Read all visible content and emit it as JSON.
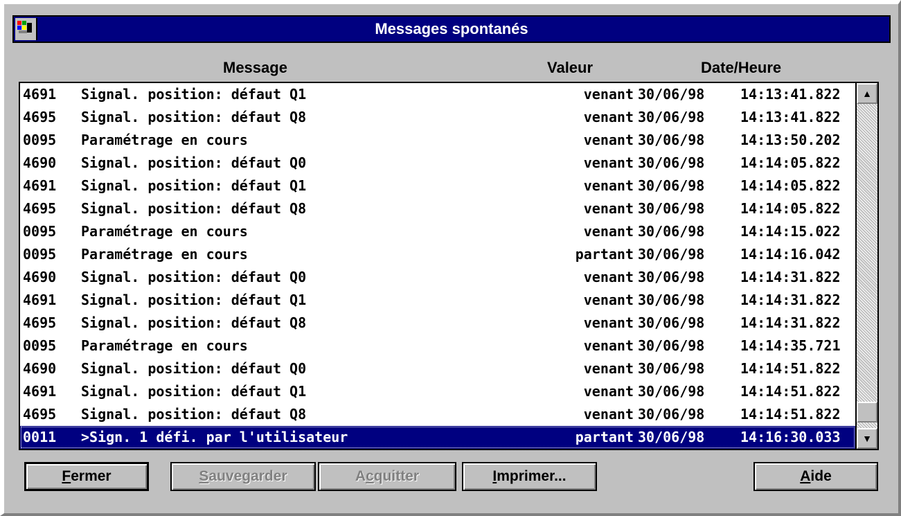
{
  "window": {
    "title": "Messages spontanés",
    "icon": "app-icon"
  },
  "columns": {
    "message": "Message",
    "valeur": "Valeur",
    "date_heure": "Date/Heure"
  },
  "rows": [
    {
      "code": "4691",
      "text": "Signal. position: défaut Q1",
      "valeur": "venant",
      "date": "30/06/98",
      "time": "14:13:41.822"
    },
    {
      "code": "4695",
      "text": "Signal. position: défaut Q8",
      "valeur": "venant",
      "date": "30/06/98",
      "time": "14:13:41.822"
    },
    {
      "code": "0095",
      "text": "Paramétrage en cours",
      "valeur": "venant",
      "date": "30/06/98",
      "time": "14:13:50.202"
    },
    {
      "code": "4690",
      "text": "Signal. position: défaut Q0",
      "valeur": "venant",
      "date": "30/06/98",
      "time": "14:14:05.822"
    },
    {
      "code": "4691",
      "text": "Signal. position: défaut Q1",
      "valeur": "venant",
      "date": "30/06/98",
      "time": "14:14:05.822"
    },
    {
      "code": "4695",
      "text": "Signal. position: défaut Q8",
      "valeur": "venant",
      "date": "30/06/98",
      "time": "14:14:05.822"
    },
    {
      "code": "0095",
      "text": "Paramétrage en cours",
      "valeur": "venant",
      "date": "30/06/98",
      "time": "14:14:15.022"
    },
    {
      "code": "0095",
      "text": "Paramétrage en cours",
      "valeur": "partant",
      "date": "30/06/98",
      "time": "14:14:16.042"
    },
    {
      "code": "4690",
      "text": "Signal. position: défaut Q0",
      "valeur": "venant",
      "date": "30/06/98",
      "time": "14:14:31.822"
    },
    {
      "code": "4691",
      "text": "Signal. position: défaut Q1",
      "valeur": "venant",
      "date": "30/06/98",
      "time": "14:14:31.822"
    },
    {
      "code": "4695",
      "text": "Signal. position: défaut Q8",
      "valeur": "venant",
      "date": "30/06/98",
      "time": "14:14:31.822"
    },
    {
      "code": "0095",
      "text": "Paramétrage en cours",
      "valeur": "venant",
      "date": "30/06/98",
      "time": "14:14:35.721"
    },
    {
      "code": "4690",
      "text": "Signal. position: défaut Q0",
      "valeur": "venant",
      "date": "30/06/98",
      "time": "14:14:51.822"
    },
    {
      "code": "4691",
      "text": "Signal. position: défaut Q1",
      "valeur": "venant",
      "date": "30/06/98",
      "time": "14:14:51.822"
    },
    {
      "code": "4695",
      "text": "Signal. position: défaut Q8",
      "valeur": "venant",
      "date": "30/06/98",
      "time": "14:14:51.822"
    },
    {
      "code": "0011",
      "text": ">Sign. 1 défi. par l'utilisateur",
      "valeur": "partant",
      "date": "30/06/98",
      "time": "14:16:30.033",
      "selected": true
    }
  ],
  "scrollbar": {
    "up_icon": "▲",
    "down_icon": "▼"
  },
  "buttons": {
    "fermer": {
      "accel": "F",
      "rest": "ermer",
      "enabled": true
    },
    "sauvegarder": {
      "accel": "S",
      "rest": "auvegarder",
      "enabled": false
    },
    "acquitter": {
      "pre": "A",
      "accel": "c",
      "rest": "quitter",
      "enabled": false
    },
    "imprimer": {
      "accel": "I",
      "rest": "mprimer...",
      "enabled": true
    },
    "aide": {
      "accel": "A",
      "rest": "ide",
      "enabled": true
    }
  },
  "colors": {
    "titlebar": "#000080",
    "selection": "#000080",
    "face": "#c0c0c0"
  }
}
